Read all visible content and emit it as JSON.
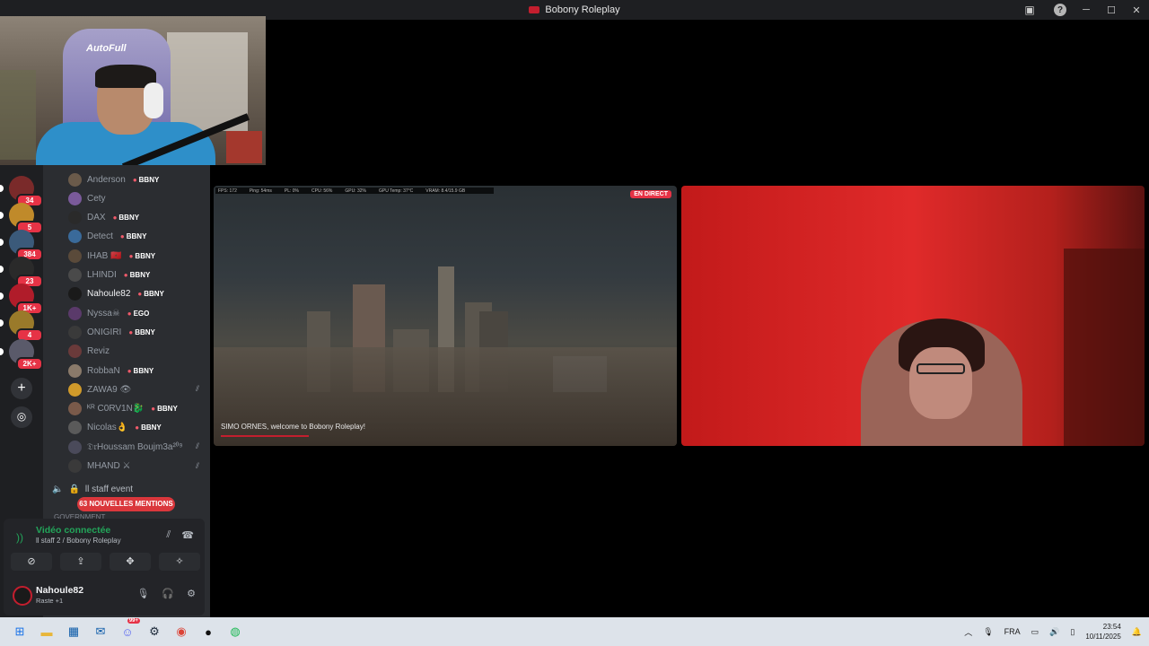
{
  "window": {
    "title": "Bobony Roleplay"
  },
  "webcam": {
    "chair_brand": "AutoFull"
  },
  "guilds": [
    {
      "badge": "34",
      "color": "#7a2a2a"
    },
    {
      "badge": "5",
      "color": "#c08a2a"
    },
    {
      "badge": "384",
      "color": "#3b5a7a"
    },
    {
      "badge": "23",
      "color": "#2a2a2a"
    },
    {
      "badge": "1K+",
      "color": "#b01c2a"
    },
    {
      "badge": "4",
      "color": "#9a7a2a"
    },
    {
      "badge": "2K+",
      "color": "#5a5a6a"
    }
  ],
  "members": [
    {
      "name": "Anderson",
      "tag": "BBNY",
      "color": "#6a5a4a"
    },
    {
      "name": "Cety",
      "tag": "",
      "color": "#7a5a9a"
    },
    {
      "name": "DAX",
      "tag": "BBNY",
      "color": "#2a2a2a"
    },
    {
      "name": "Detect",
      "tag": "BBNY",
      "color": "#3a6a9a"
    },
    {
      "name": "IHAB 🇲🇦",
      "tag": "BBNY",
      "color": "#5a4a3a"
    },
    {
      "name": "LHINDI",
      "tag": "BBNY",
      "color": "#4a4a4a"
    },
    {
      "name": "Nahoule82",
      "tag": "BBNY",
      "color": "#1a1a1a",
      "bright": true
    },
    {
      "name": "Nyssa☠",
      "tag": "EGO",
      "color": "#5a3a6a"
    },
    {
      "name": "ONIGIRI",
      "tag": "BBNY",
      "color": "#3a3a3a"
    },
    {
      "name": "Reviz",
      "tag": "",
      "color": "#6a3a3a"
    },
    {
      "name": "RobbaN",
      "tag": "BBNY",
      "color": "#8a7a6a"
    },
    {
      "name": "ZAWA9 👁",
      "tag": "",
      "color": "#d09a2a",
      "muted": true
    },
    {
      "name": "ᴷᴿ C0RV1N🐉",
      "tag": "BBNY",
      "color": "#7a5a4a"
    },
    {
      "name": "Nicolas👌",
      "tag": "BBNY",
      "color": "#5a5a5a"
    },
    {
      "name": "𝔇𝔯Houssam Boujm3a²⁰⁹",
      "tag": "",
      "color": "#4a4a5a",
      "muted": true
    },
    {
      "name": "MHAND ⚔",
      "tag": "",
      "color": "#3a3a3a",
      "muted": true
    }
  ],
  "voice_channel": {
    "name": "ll staff event"
  },
  "mentions": {
    "label": "63 NOUVELLES MENTIONS"
  },
  "category": {
    "label": "GOVERNMENT"
  },
  "voice_panel": {
    "status": "Vidéo connectée",
    "channel": "ll staff 2 / Bobony Roleplay"
  },
  "user": {
    "name": "Nahoule82",
    "status": "Raste +1"
  },
  "stream": {
    "live_badge": "EN DIRECT",
    "hud": [
      "FPS: 172",
      "Ping: 54ms",
      "PL: 0%",
      "CPU: 56%",
      "GPU: 32%",
      "GPU Temp: 37°C",
      "VRAM: 8.4/15.9 GB"
    ],
    "chat_message": "SIMO ORNES, welcome to Bobony Roleplay!"
  },
  "taskbar": {
    "discord_badge": "99+",
    "language": "FRA",
    "time": "23:54",
    "date": "10/11/2025"
  },
  "colors": {
    "accent": "#e63346",
    "connected": "#23a55a",
    "bg_panel": "#2b2d31"
  }
}
